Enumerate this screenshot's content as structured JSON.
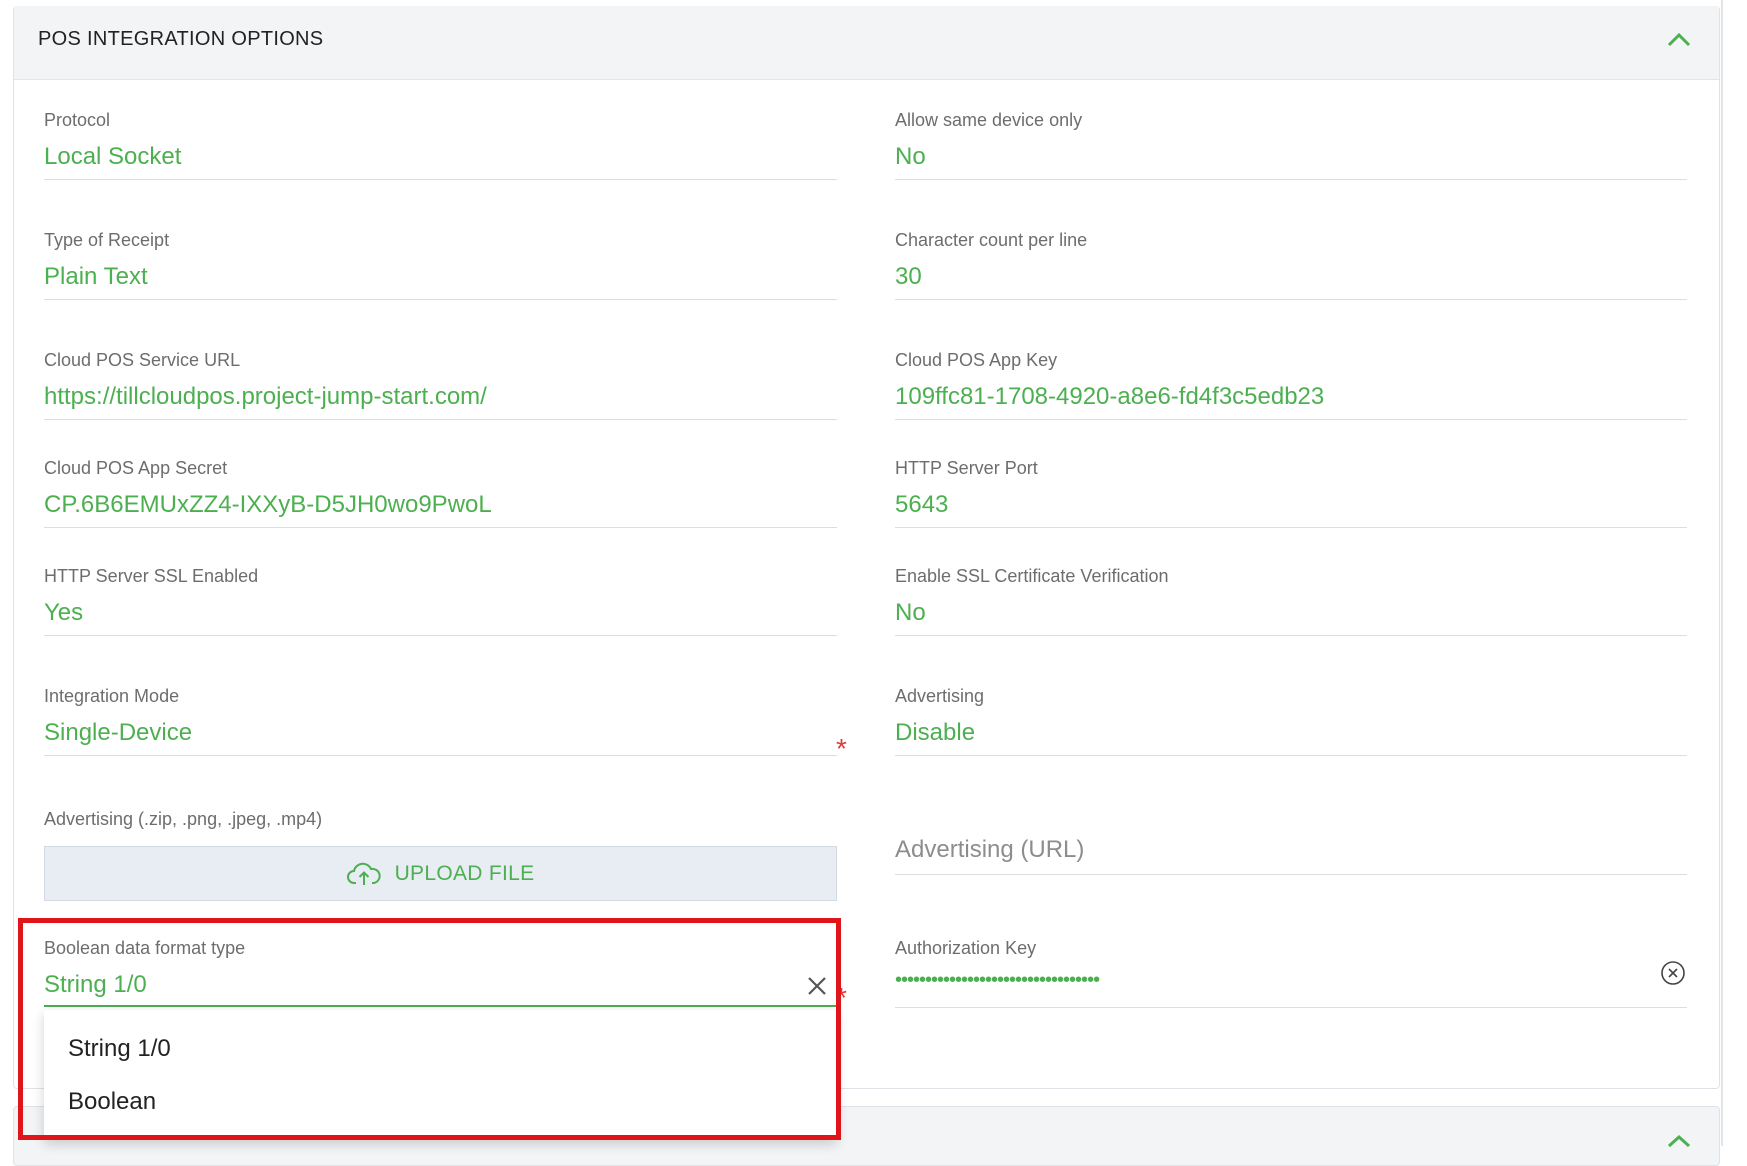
{
  "panel": {
    "title": "POS INTEGRATION OPTIONS",
    "collapse_icon": "chevron-up-icon"
  },
  "fields": {
    "protocol": {
      "label": "Protocol",
      "value": "Local Socket"
    },
    "allow_same_device": {
      "label": "Allow same device only",
      "value": "No"
    },
    "receipt_type": {
      "label": "Type of Receipt",
      "value": "Plain Text"
    },
    "char_count": {
      "label": "Character count per line",
      "value": "30"
    },
    "service_url": {
      "label": "Cloud POS Service URL",
      "value": "https://tillcloudpos.project-jump-start.com/"
    },
    "app_key": {
      "label": "Cloud POS App Key",
      "value": "109ffc81-1708-4920-a8e6-fd4f3c5edb23"
    },
    "app_secret": {
      "label": "Cloud POS App Secret",
      "value": "CP.6B6EMUxZZ4-IXXyB-D5JH0wo9PwoL"
    },
    "http_port": {
      "label": "HTTP Server Port",
      "value": "5643"
    },
    "ssl_enabled": {
      "label": "HTTP Server SSL Enabled",
      "value": "Yes"
    },
    "ssl_verification": {
      "label": "Enable SSL Certificate Verification",
      "value": "No"
    },
    "integration_mode": {
      "label": "Integration Mode",
      "value": "Single-Device",
      "required_mark": "*"
    },
    "advertising": {
      "label": "Advertising",
      "value": "Disable"
    },
    "advertising_file": {
      "label": "Advertising (.zip, .png, .jpeg, .mp4)",
      "button_label": "UPLOAD FILE",
      "button_icon": "cloud-upload-icon"
    },
    "advertising_url": {
      "placeholder": "Advertising (URL)"
    },
    "boolean_format": {
      "label": "Boolean data format type",
      "value": "String 1/0",
      "required_mark": "*",
      "clear_icon": "close-icon"
    },
    "auth_key": {
      "label": "Authorization Key",
      "value": "••••••••••••••••••••••••••••••••••",
      "clear_icon": "circle-close-icon"
    }
  },
  "dropdown": {
    "options": [
      "String 1/0",
      "Boolean"
    ]
  },
  "colors": {
    "accent": "#4caf50",
    "required": "#e53935",
    "highlight": "#e0151a"
  }
}
